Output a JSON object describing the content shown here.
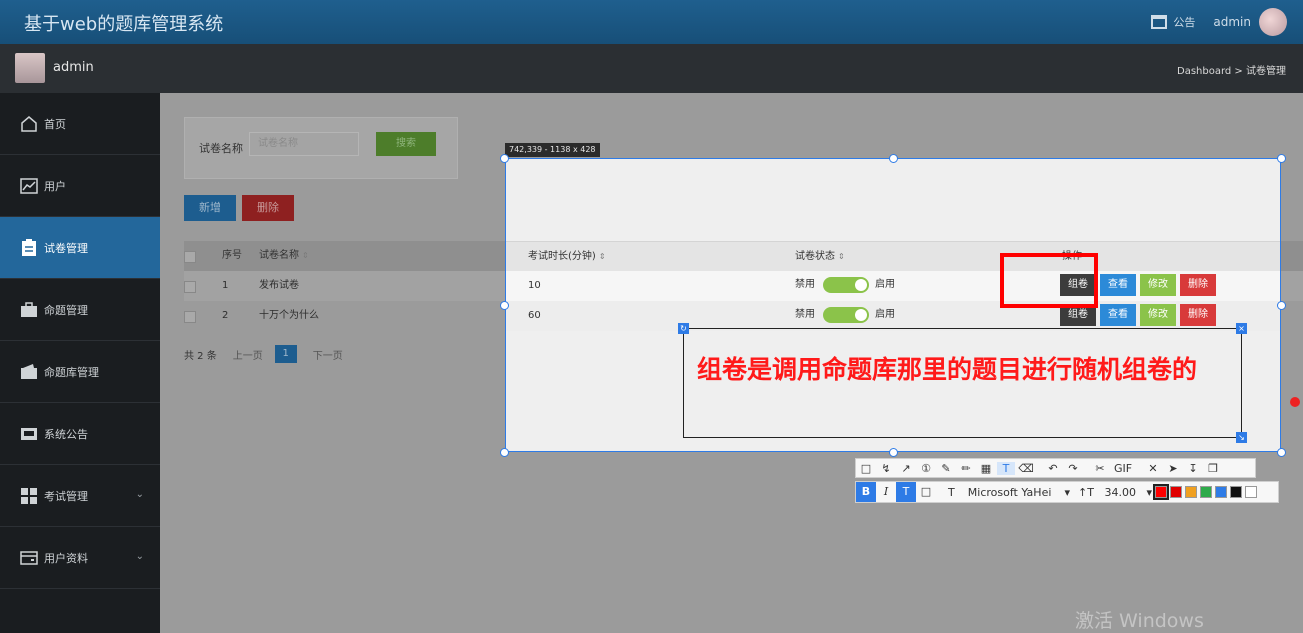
{
  "app": {
    "title": "基于web的题库管理系统"
  },
  "topbar": {
    "notice_label": "公告",
    "username": "admin"
  },
  "subbar": {
    "username": "admin",
    "breadcrumb": "Dashboard > 试卷管理"
  },
  "sidebar": {
    "items": [
      {
        "label": "首页",
        "icon": "home-icon"
      },
      {
        "label": "用户",
        "icon": "chart-icon"
      },
      {
        "label": "试卷管理",
        "icon": "clipboard-icon",
        "active": true
      },
      {
        "label": "命题管理",
        "icon": "briefcase-icon"
      },
      {
        "label": "命题库管理",
        "icon": "wallet-icon"
      },
      {
        "label": "系统公告",
        "icon": "inbox-icon"
      },
      {
        "label": "考试管理",
        "icon": "grid-icon",
        "expandable": true
      },
      {
        "label": "用户资料",
        "icon": "card-icon",
        "expandable": true
      }
    ]
  },
  "search": {
    "label": "试卷名称",
    "placeholder": "试卷名称",
    "button": "搜索"
  },
  "actions": {
    "add": "新增",
    "delete": "删除"
  },
  "table": {
    "headers": [
      "序号",
      "试卷名称",
      "考试时长(分钟)",
      "试卷状态",
      "操作"
    ],
    "rows": [
      {
        "index": "1",
        "name": "发布试卷",
        "duration": "10",
        "status_off": "禁用",
        "status_on": "启用"
      },
      {
        "index": "2",
        "name": "十万个为什么",
        "duration": "60",
        "status_off": "禁用",
        "status_on": "启用"
      }
    ],
    "row_actions": {
      "compose": "组卷",
      "view": "查看",
      "edit": "修改",
      "remove": "删除"
    }
  },
  "pager": {
    "total": "共 2 条",
    "prev": "上一页",
    "current": "1",
    "next": "下一页"
  },
  "capture": {
    "size_label": "742,339 - 1138 x 428",
    "annotation": "组卷是调用命题库那里的题目进行随机组卷的",
    "font": "Microsoft YaHei",
    "font_size": "34.00",
    "gif_label": "GIF",
    "colors": [
      "#ff0000",
      "#e00000",
      "#f0a020",
      "#2eaa4a",
      "#2e7be6",
      "#111111",
      "#ffffff"
    ],
    "active_color": "#ff0000"
  },
  "watermark": "激活 Windows"
}
